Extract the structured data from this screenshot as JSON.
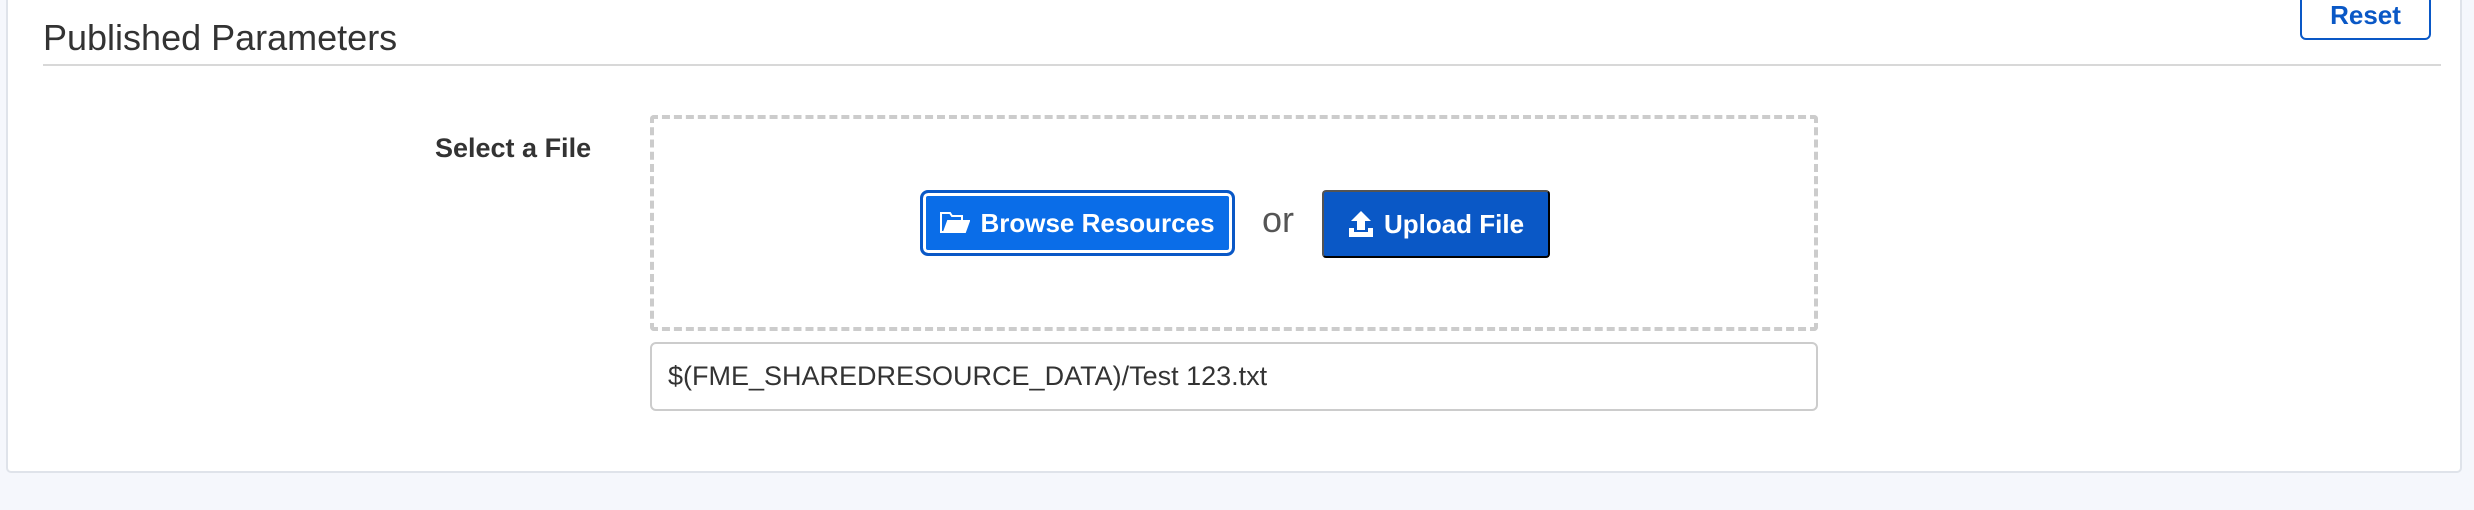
{
  "section": {
    "title": "Published Parameters",
    "reset_label": "Reset"
  },
  "field": {
    "label": "Select a File",
    "browse_label": "Browse Resources",
    "browse_icon": "folder-open-icon",
    "or_text": "or",
    "upload_label": "Upload File",
    "upload_icon": "upload-icon",
    "path_value": "$(FME_SHAREDRESOURCE_DATA)/Test 123.txt"
  },
  "colors": {
    "primary": "#0a58c6",
    "primary_light": "#0a6de8",
    "background": "#f5f7fc"
  }
}
